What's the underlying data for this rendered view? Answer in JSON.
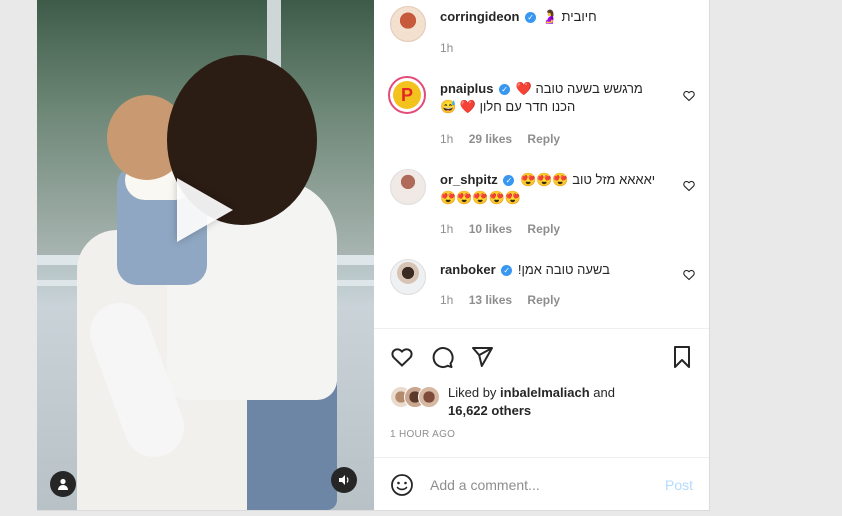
{
  "video": {
    "play_label": "",
    "user_icon": "person-icon",
    "sound_icon": "speaker-icon"
  },
  "comments": [
    {
      "username": "corringideon",
      "text": "חיובית 🤰",
      "time": "1h",
      "likes": "",
      "reply": ""
    },
    {
      "username": "pnaiplus",
      "text": "מרגשש בשעה טובה ❤️",
      "text2": "הכנו חדר עם חלון ❤️ 😅",
      "time": "1h",
      "likes": "29 likes",
      "reply": "Reply"
    },
    {
      "username": "or_shpitz",
      "text": "יאאאא מזל טוב 😍😍😍",
      "text2": "😍😍😍😍😍",
      "time": "1h",
      "likes": "10 likes",
      "reply": "Reply"
    },
    {
      "username": "ranboker",
      "text": "בשעה טובה אמן!",
      "time": "1h",
      "likes": "13 likes",
      "reply": "Reply"
    }
  ],
  "likes": {
    "prefix": "Liked by",
    "user": "inbalelmaliach",
    "and": "and",
    "others": "16,622 others"
  },
  "timestamp": "1 HOUR AGO",
  "add_comment": {
    "placeholder": "Add a comment...",
    "post": "Post"
  },
  "colors": {
    "verified": "#3897f0",
    "post_disabled": "#b3dbff"
  }
}
